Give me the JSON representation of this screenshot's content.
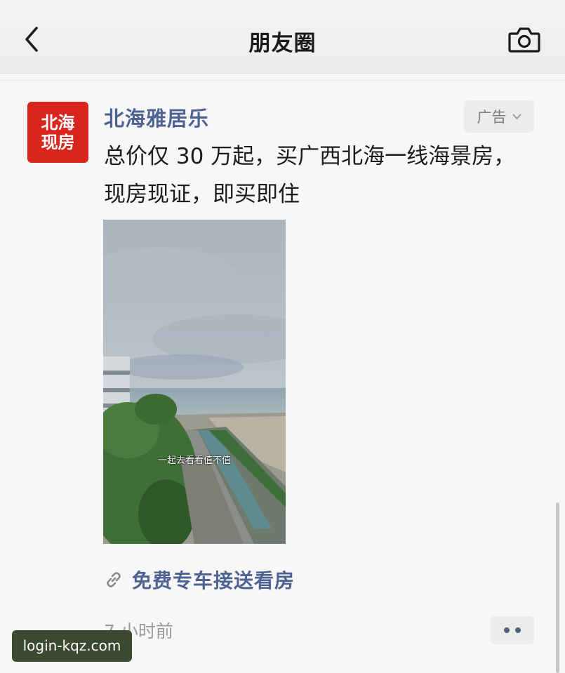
{
  "navbar": {
    "title": "朋友圈",
    "back_icon": "back-chevron-icon",
    "camera_icon": "camera-icon"
  },
  "post": {
    "avatar_lines": [
      "北海",
      "现房"
    ],
    "author": "北海雅居乐",
    "ad_badge": "广告",
    "text": "总价仅 30 万起，买广西北海一线海景房，现房现证，即买即住",
    "video_caption": "一起去看看值不值",
    "link_label": "免费专车接送看房",
    "link_icon": "link-icon",
    "timestamp": "7 小时前",
    "more_icon": "more-dots-icon"
  },
  "watermark": "login-kqz.com",
  "colors": {
    "link_blue": "#4f6392",
    "avatar_red": "#d8261e",
    "background": "#f7f7f7"
  }
}
